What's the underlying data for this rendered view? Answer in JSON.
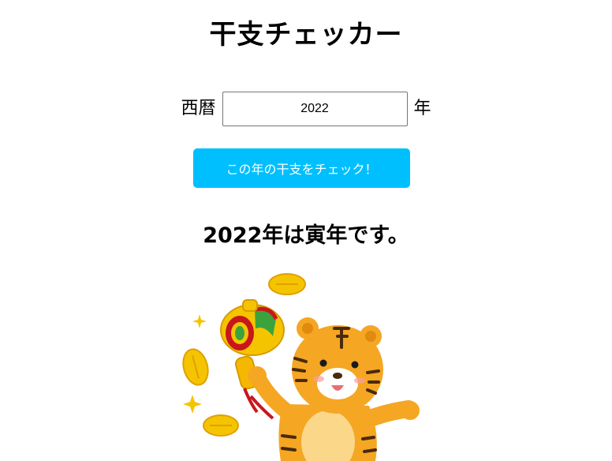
{
  "header": {
    "title": "干支チェッカー"
  },
  "form": {
    "prefix_label": "西暦",
    "year_value": "2022",
    "suffix_label": "年",
    "button_label": "この年の干支をチェック！"
  },
  "result": {
    "text": "2022年は寅年です。"
  },
  "colors": {
    "button_bg": "#00bfff",
    "button_text": "#ffffff"
  },
  "illustration": {
    "icon": "tiger-with-lucky-mallet-icon"
  }
}
